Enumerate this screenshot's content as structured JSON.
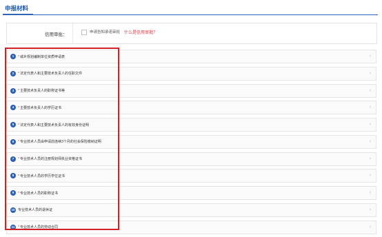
{
  "section": {
    "title": "申报材料"
  },
  "credit": {
    "label": "信用审批：",
    "checkbox_text": "申请告知承诺审批",
    "link": "什么是信用审批？"
  },
  "items": [
    {
      "no": "1",
      "label": "城乡规划编制单位资质申请表",
      "required": true
    },
    {
      "no": "2",
      "label": "法定代表人和主要技术负责人的任职文件",
      "required": true
    },
    {
      "no": "3",
      "label": "主要技术负责人的职称证书等",
      "required": true
    },
    {
      "no": "4",
      "label": "主要技术负责人的学历证书",
      "required": true
    },
    {
      "no": "5",
      "label": "法定代表人和主要技术负责人的有效身份证明",
      "required": true
    },
    {
      "no": "6",
      "label": "专业技术人员由申请前连续3个月的社会保险缴纳证明",
      "required": true
    },
    {
      "no": "7",
      "label": "专业技术人员的注册规划师执业资格证书",
      "required": true
    },
    {
      "no": "8",
      "label": "专业技术人员的学历学位证书",
      "required": true
    },
    {
      "no": "9",
      "label": "专业技术人员的职称证书",
      "required": true
    },
    {
      "no": "10",
      "label": "专业技术人员的退休证",
      "required": false
    },
    {
      "no": "11",
      "label": "专业技术人员的劳动合同",
      "required": true
    }
  ],
  "colors": {
    "accent": "#2b5fb2",
    "required": "#e0363a",
    "highlight": "#d32026"
  },
  "icons": {
    "chevron": "chevron-right-icon"
  }
}
